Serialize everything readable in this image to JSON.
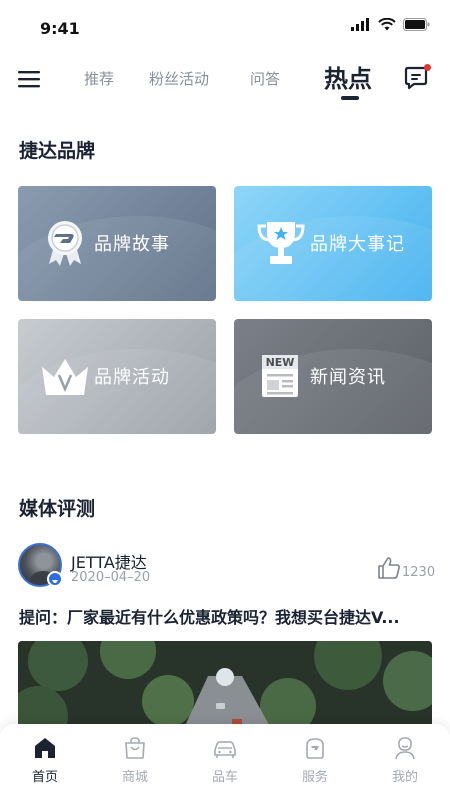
{
  "status_bar": {
    "time": "9:41"
  },
  "nav": {
    "tabs": [
      {
        "label": "推荐",
        "active": false
      },
      {
        "label": "粉丝活动",
        "active": false
      },
      {
        "label": "问答",
        "active": false
      },
      {
        "label": "热点",
        "active": true
      }
    ],
    "has_unread_message": true
  },
  "brand_section": {
    "title": "捷达品牌",
    "cards": [
      {
        "label": "品牌故事",
        "icon": "medal-icon"
      },
      {
        "label": "品牌大事记",
        "icon": "trophy-icon"
      },
      {
        "label": "品牌活动",
        "icon": "crown-icon"
      },
      {
        "label": "新闻资讯",
        "icon": "newspaper-icon"
      }
    ]
  },
  "media_section": {
    "title": "媒体评测",
    "post": {
      "author": "JETTA捷达",
      "date": "2020–04–20",
      "likes": "1230",
      "text": "提问：厂家最近有什么优惠政策吗？我想买台捷达V..."
    }
  },
  "tab_bar": {
    "tabs": [
      {
        "label": "首页",
        "icon": "home-icon",
        "active": true
      },
      {
        "label": "商城",
        "icon": "shopping-bag-icon",
        "active": false
      },
      {
        "label": "品车",
        "icon": "car-icon",
        "active": false
      },
      {
        "label": "服务",
        "icon": "service-icon",
        "active": false
      },
      {
        "label": "我的",
        "icon": "profile-icon",
        "active": false
      }
    ]
  },
  "colors": {
    "primary_dark": "#1b2333",
    "muted_text": "#8a9099",
    "notification_red": "#e8332f",
    "accent_blue": "#3b6fd8"
  }
}
